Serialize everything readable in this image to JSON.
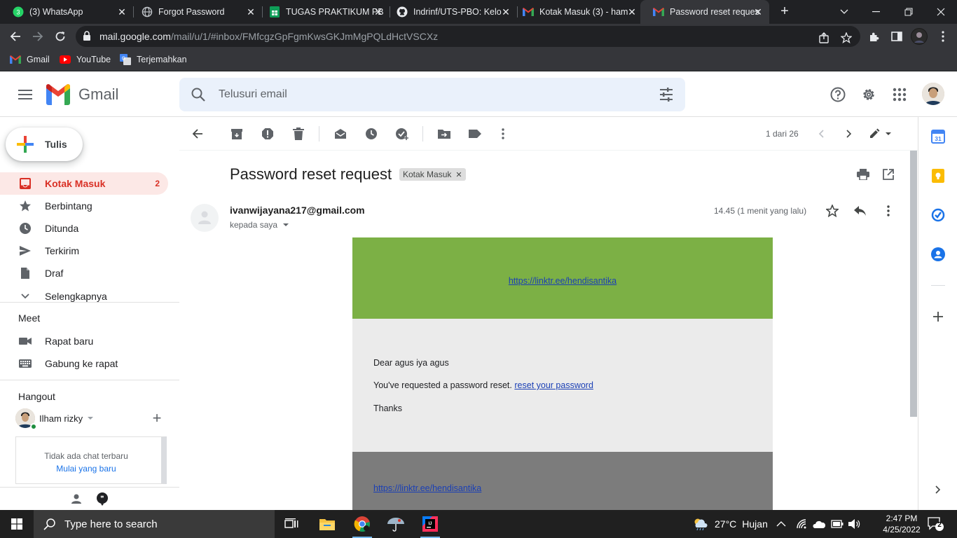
{
  "browser": {
    "tabs": [
      {
        "title": "(3) WhatsApp",
        "icon": "whatsapp-icon"
      },
      {
        "title": "Forgot Password",
        "icon": "globe-icon"
      },
      {
        "title": "TUGAS PRAKTIKUM PB",
        "icon": "sheets-icon"
      },
      {
        "title": "Indrinf/UTS-PBO: Kelo",
        "icon": "github-icon"
      },
      {
        "title": "Kotak Masuk (3) - ham",
        "icon": "gmail-icon"
      },
      {
        "title": "Password reset reques",
        "icon": "gmail-icon"
      }
    ],
    "url_host": "mail.google.com",
    "url_path": "/mail/u/1/#inbox/FMfcgzGpFgmKwsGKJmMgPQLdHctVSCXz",
    "bookmarks": [
      {
        "label": "Gmail"
      },
      {
        "label": "YouTube"
      },
      {
        "label": "Terjemahkan"
      }
    ]
  },
  "gmail": {
    "logo_text": "Gmail",
    "search_placeholder": "Telusuri email",
    "compose_label": "Tulis",
    "nav": [
      {
        "label": "Kotak Masuk",
        "count": "2"
      },
      {
        "label": "Berbintang",
        "count": ""
      },
      {
        "label": "Ditunda",
        "count": ""
      },
      {
        "label": "Terkirim",
        "count": ""
      },
      {
        "label": "Draf",
        "count": ""
      },
      {
        "label": "Selengkapnya",
        "count": ""
      }
    ],
    "meet": {
      "heading": "Meet",
      "items": [
        {
          "label": "Rapat baru"
        },
        {
          "label": "Gabung ke rapat"
        }
      ]
    },
    "hangout": {
      "heading": "Hangout",
      "user": "Ilham rizky",
      "empty_text": "Tidak ada chat terbaru",
      "start_link": "Mulai yang baru"
    },
    "pagination": "1 dari 26",
    "message": {
      "subject": "Password reset request",
      "label": "Kotak Masuk",
      "sender": "ivanwijayana217@gmail.com",
      "to": "kepada saya",
      "time": "14.45 (1 menit yang lalu)",
      "body": {
        "header_link": "https://linktr.ee/hendisantika",
        "greeting": "Dear agus iya agus",
        "line1": "You've requested a password reset.",
        "reset_link": "reset your password",
        "closing": "Thanks",
        "footer_link": "https://linktr.ee/hendisantika"
      }
    }
  },
  "taskbar": {
    "search_text": "Type here to search",
    "weather_temp": "27°C",
    "weather_desc": "Hujan",
    "time": "2:47 PM",
    "date": "4/25/2022",
    "notification_count": "2"
  },
  "colors": {
    "accent_red": "#d93025",
    "email_green": "#7cb045",
    "email_gray": "#ebebeb",
    "email_footer": "#7c7c7c",
    "link_blue": "#1a3fb5"
  }
}
